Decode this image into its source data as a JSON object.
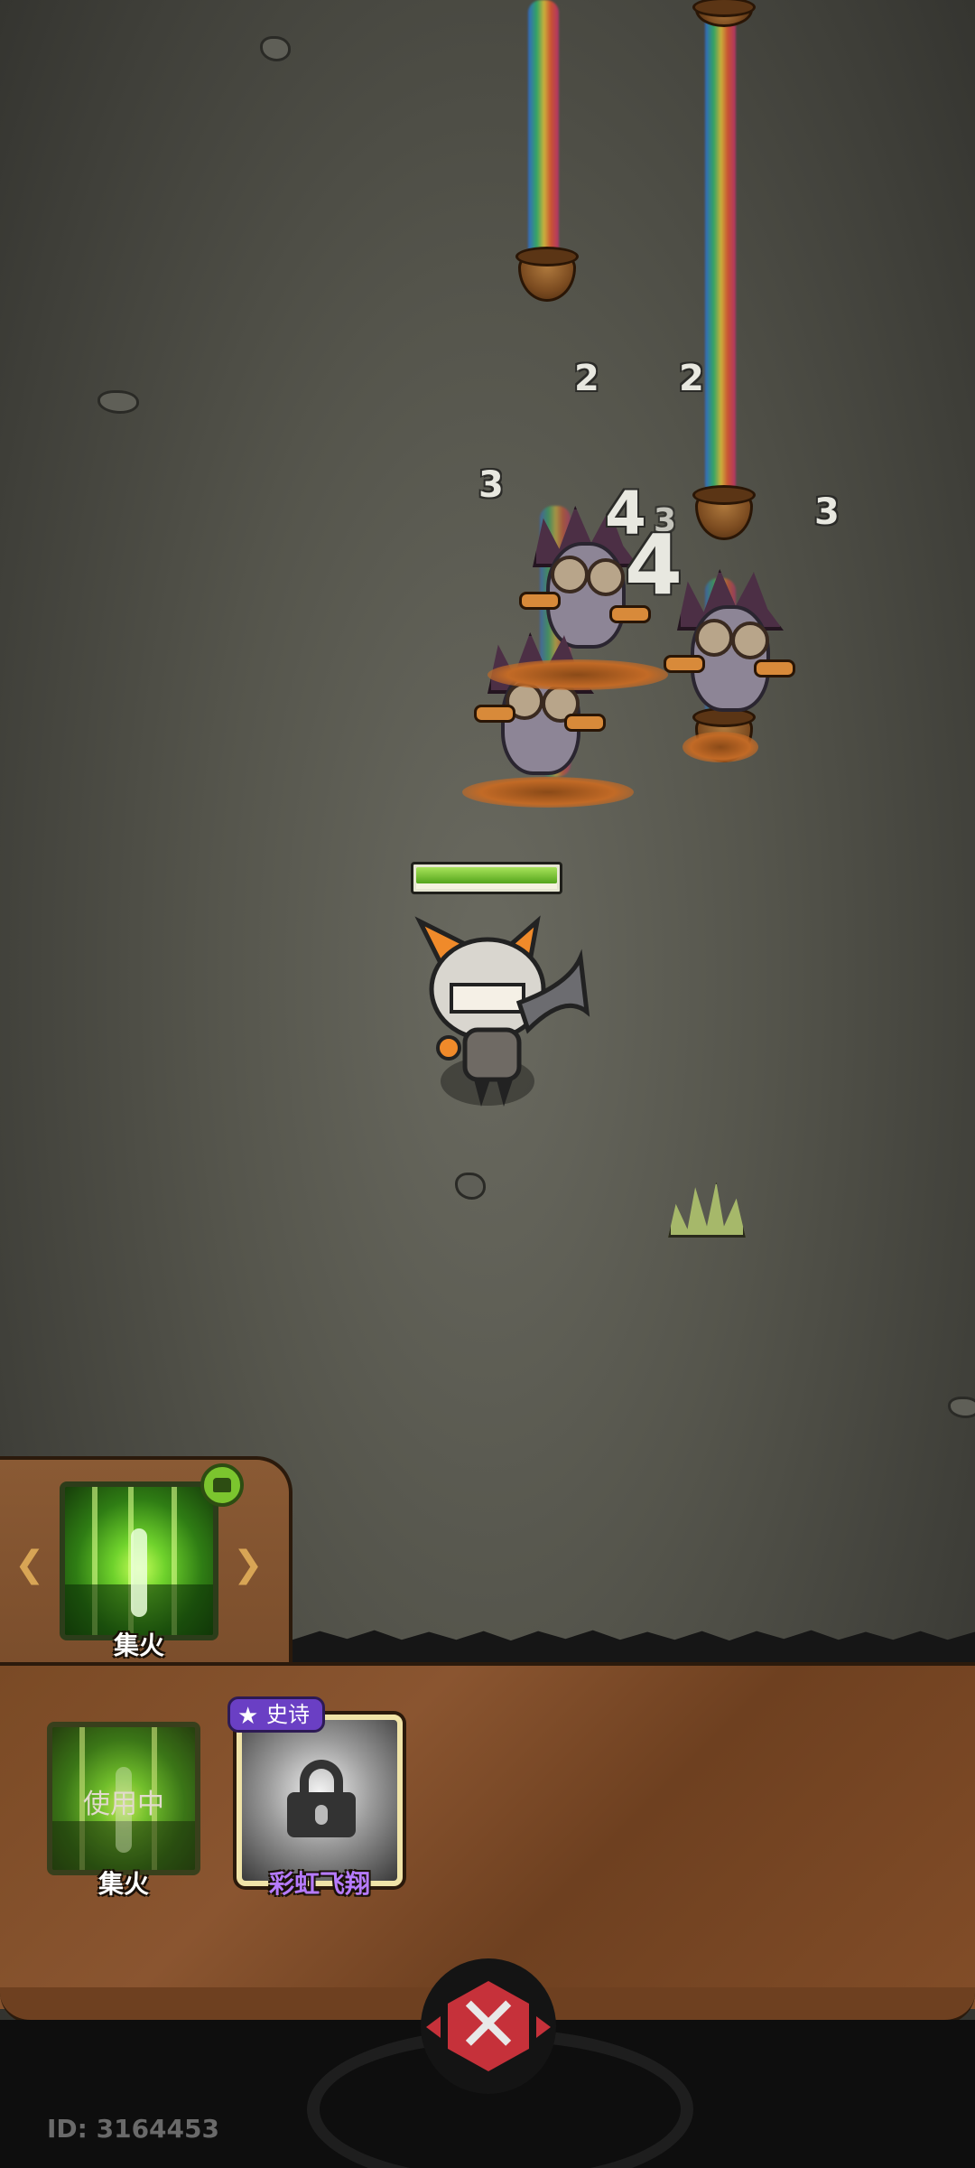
{
  "damage_numbers": [
    "2",
    "2",
    "3",
    "3",
    "4",
    "3",
    "4"
  ],
  "skill_slot": {
    "active": {
      "label": "集火"
    },
    "equipped": {
      "label": "集火",
      "status": "使用中"
    },
    "locked": {
      "label": "彩虹飞翔",
      "rarity": "史诗"
    }
  },
  "footer": {
    "user_id": "ID: 3164453"
  },
  "colors": {
    "panel_brown": "#7a4a25",
    "skill_green": "#6fd22c",
    "epic_purple": "#6a3fc4",
    "close_red": "#c6313a"
  },
  "icons": [
    "rainbow-beam-icon",
    "acorn-icon",
    "lock-icon",
    "star-icon",
    "close-x-icon",
    "arrow-left-icon",
    "arrow-right-icon",
    "skill-badge-icon"
  ]
}
